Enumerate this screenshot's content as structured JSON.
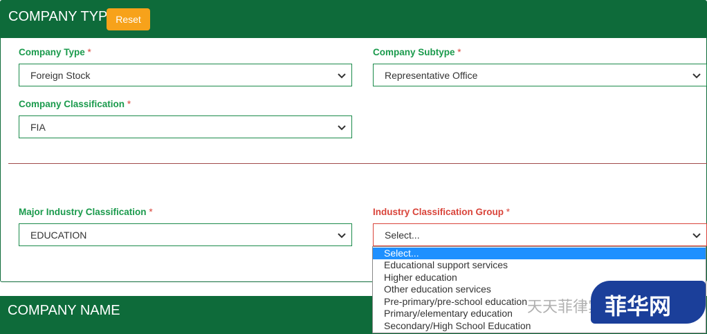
{
  "section1": {
    "title": "COMPANY TYPE",
    "reset_label": "Reset"
  },
  "fields": {
    "company_type": {
      "label": "Company Type",
      "required": "*",
      "value": "Foreign Stock"
    },
    "company_subtype": {
      "label": "Company Subtype",
      "required": "*",
      "value": "Representative Office"
    },
    "company_classification": {
      "label": "Company Classification",
      "required": "*",
      "value": "FIA"
    },
    "major_industry": {
      "label": "Major Industry Classification",
      "required": "*",
      "value": "EDUCATION"
    },
    "industry_group": {
      "label": "Industry Classification Group",
      "required": "*",
      "value": "Select..."
    }
  },
  "industry_group_options": [
    "Select...",
    "Educational support services",
    "Higher education",
    "Other education services",
    "Pre-primary/pre-school education",
    "Primary/elementary education",
    "Secondary/High School Education"
  ],
  "section2": {
    "title": "COMPANY NAME"
  },
  "watermark": {
    "text": "天天菲律宾",
    "logo": "菲华网"
  },
  "colors": {
    "header_green": "#0e6b3a",
    "label_green": "#1a9a4c",
    "reset_orange": "#f7a21a",
    "error_red": "#d9443a",
    "selected_blue": "#1e90ff"
  }
}
